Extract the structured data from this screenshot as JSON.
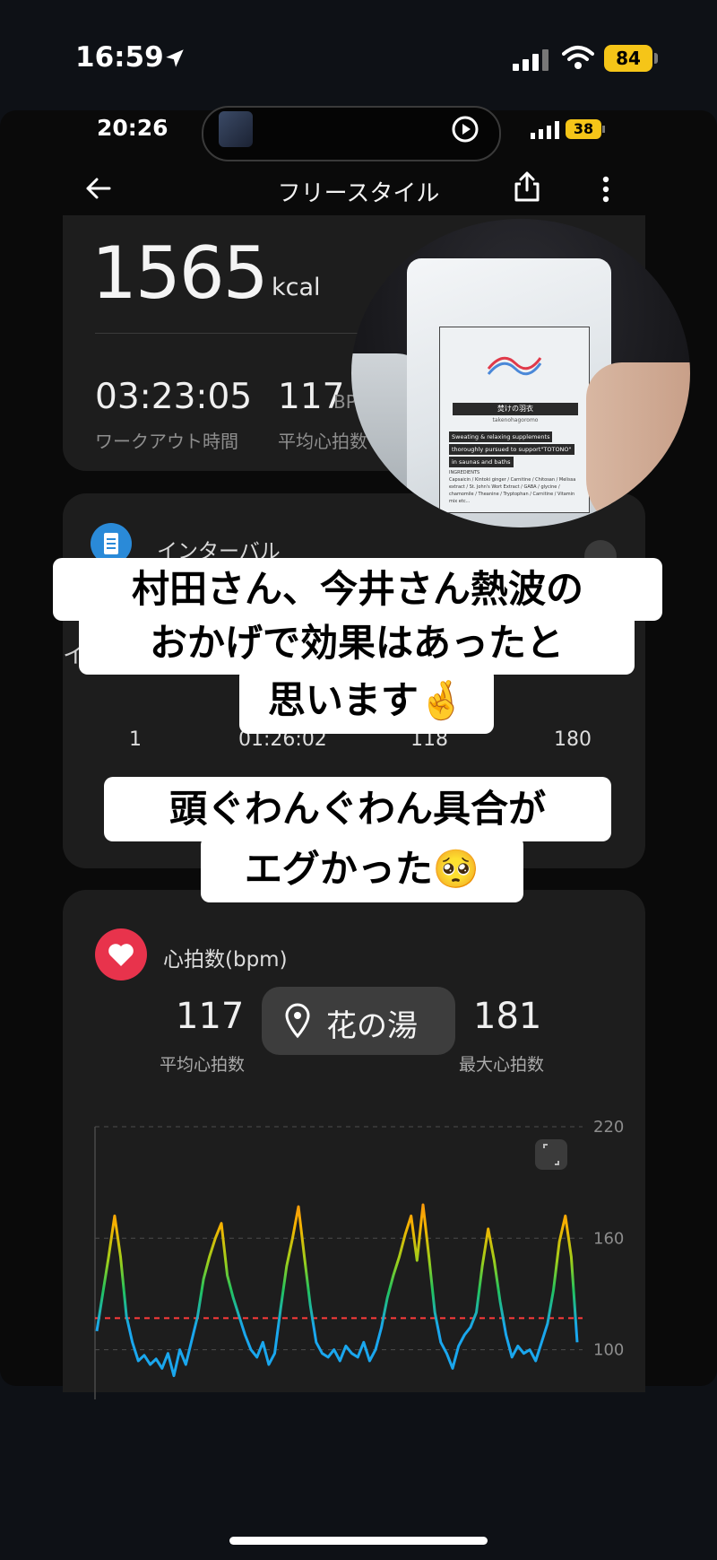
{
  "outer_status": {
    "time": "16:59",
    "battery": "84"
  },
  "inner_status": {
    "time": "20:26",
    "battery": "38"
  },
  "header": {
    "title": "フリースタイル"
  },
  "summary": {
    "calories": "1565",
    "calories_unit": "kcal",
    "duration": "03:23:05",
    "duration_label": "ワークアウト時間",
    "avg_hr": "117",
    "avg_hr_unit": "BP",
    "avg_hr_label": "平均心拍数"
  },
  "interval": {
    "title": "インターバル",
    "partial_text": "イ",
    "row": {
      "lap": "1",
      "time": "01:26:02",
      "avg": "118",
      "max": "180"
    }
  },
  "heart_rate": {
    "title": "心拍数(bpm)",
    "avg_value": "117",
    "avg_label": "平均心拍数",
    "max_value": "181",
    "max_label": "最大心拍数",
    "location": "花の湯"
  },
  "chart_data": {
    "type": "line",
    "y_ticks": [
      "220",
      "160",
      "100"
    ],
    "ylim": [
      80,
      220
    ],
    "grid": true,
    "reference_line": 117,
    "series": [
      {
        "values": [
          110,
          130,
          150,
          172,
          150,
          118,
          104,
          94,
          97,
          92,
          95,
          90,
          98,
          86,
          100,
          92,
          105,
          118,
          138,
          150,
          160,
          168,
          140,
          128,
          118,
          108,
          100,
          96,
          104,
          92,
          98,
          122,
          145,
          160,
          177,
          150,
          124,
          104,
          98,
          96,
          100,
          94,
          102,
          98,
          96,
          104,
          94,
          100,
          112,
          128,
          140,
          150,
          162,
          172,
          148,
          178,
          150,
          120,
          104,
          98,
          90,
          102,
          108,
          112,
          120,
          145,
          165,
          148,
          126,
          108,
          96,
          102,
          98,
          100,
          94,
          104,
          114,
          132,
          158,
          172,
          150,
          104
        ]
      }
    ]
  },
  "photo": {
    "brand": "焚けの羽衣",
    "brand_sub": "takenohagoromo",
    "desc": [
      "Sweating & relaxing supplements",
      "thoroughly pursued to support\"TOTONO\"",
      "in saunas and baths"
    ],
    "ingredients_heading": "INGREDIENTS",
    "ingredients": "Capsaicin / Kintoki ginger / Carnitine / Chitosan / Melissa extract / St. John's Wort Extract / GABA / glycine / chamomile / Theanine / Tryptophan / Carnitine / Vitamin mix etc..."
  },
  "stickers": {
    "line1": "村田さん、今井さん熱波の",
    "line2": "おかげで効果はあったと",
    "line3": "思います🤞",
    "line4": "頭ぐわんぐわん具合が",
    "line5": "エグかった🥺"
  }
}
